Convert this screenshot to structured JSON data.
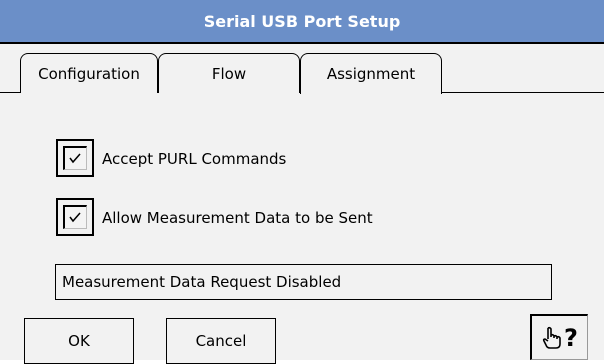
{
  "dialog": {
    "title": "Serial USB Port Setup"
  },
  "tabs": [
    {
      "label": "Configuration",
      "active": false
    },
    {
      "label": "Flow",
      "active": false
    },
    {
      "label": "Assignment",
      "active": true
    }
  ],
  "options": {
    "accept_purl": {
      "label": "Accept PURL Commands",
      "checked": true
    },
    "allow_measurement": {
      "label": "Allow Measurement Data to be Sent",
      "checked": true
    }
  },
  "status": {
    "text": "Measurement Data Request Disabled"
  },
  "buttons": {
    "ok_label": "OK",
    "cancel_label": "Cancel",
    "help_icon": "pointing-hand-help-icon"
  },
  "colors": {
    "titlebar": "#6b8fc8",
    "background": "#f2f2f2"
  }
}
